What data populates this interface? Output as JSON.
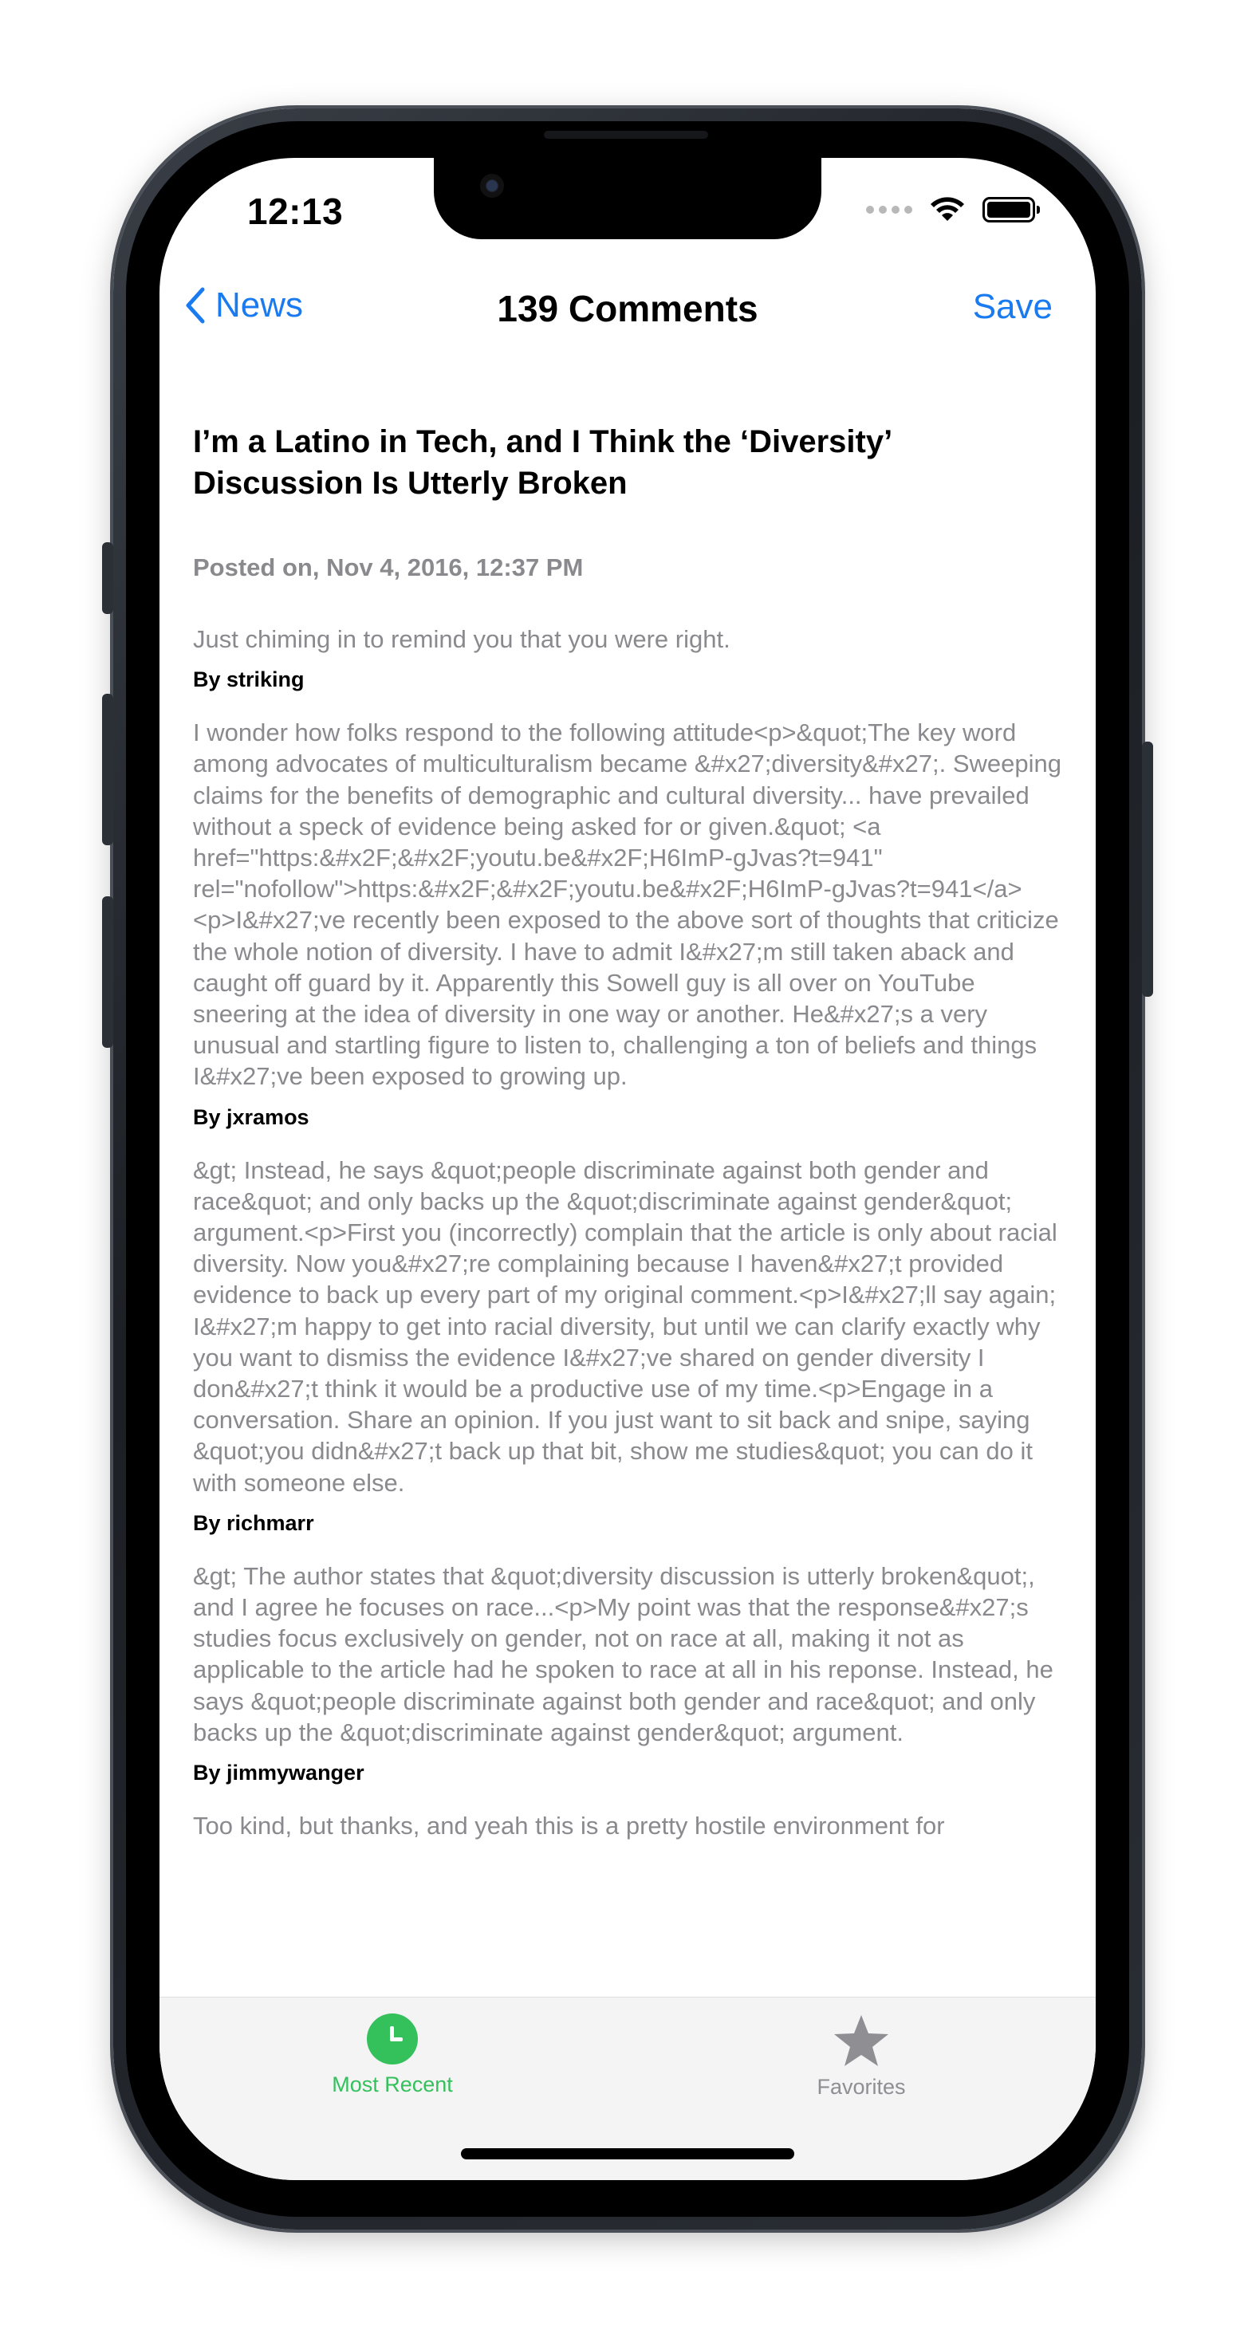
{
  "status_bar": {
    "time": "12:13"
  },
  "nav": {
    "back_label": "News",
    "title": "139 Comments",
    "save_label": "Save"
  },
  "article": {
    "title": "I’m a Latino in Tech, and I Think the ‘Diversity’ Discussion Is Utterly Broken",
    "posted": "Posted on, Nov 4, 2016, 12:37 PM"
  },
  "comments": [
    {
      "text": "Just chiming in to remind you that you were right.",
      "author": "By striking"
    },
    {
      "text": "I wonder how folks respond to the following attitude<p>&quot;The key word among advocates of multiculturalism became &#x27;diversity&#x27;. Sweeping claims for the benefits of demographic and cultural diversity... have prevailed without a speck of evidence being asked for or given.&quot; <a href=\"https:&#x2F;&#x2F;youtu.be&#x2F;H6ImP-gJvas?t=941\" rel=\"nofollow\">https:&#x2F;&#x2F;youtu.be&#x2F;H6ImP-gJvas?t=941</a><p>I&#x27;ve recently been exposed to the above sort of thoughts that criticize the whole notion of diversity. I have to admit I&#x27;m still taken aback and caught off guard by it. Apparently this Sowell guy is all over on YouTube sneering at the idea of diversity in one way or another. He&#x27;s a very unusual and startling figure to listen to, challenging a ton of beliefs and things I&#x27;ve been exposed to growing up.",
      "author": "By jxramos"
    },
    {
      "text": "&gt; Instead, he says &quot;people discriminate against both gender and race&quot; and only backs up the &quot;discriminate against gender&quot; argument.<p>First you (incorrectly) complain that the article is only about racial diversity. Now you&#x27;re complaining because I haven&#x27;t provided evidence to back up every part of my original comment.<p>I&#x27;ll say again; I&#x27;m happy to get into racial diversity, but until we can clarify exactly why you want to dismiss the evidence I&#x27;ve shared on gender diversity I don&#x27;t think it would be a productive use of my time.<p>Engage in a conversation. Share an opinion. If you just want to sit back and snipe, saying &quot;you didn&#x27;t back up that bit, show me studies&quot; you can do it with someone else.",
      "author": "By richmarr"
    },
    {
      "text": "&gt; The author states that &quot;diversity discussion is utterly broken&quot;, and I agree he focuses on race...<p>My point was that the response&#x27;s studies focus exclusively on gender, not on race at all, making it not as applicable to the article had he spoken to race at all in his reponse. Instead, he says &quot;people discriminate against both gender and race&quot; and only backs up the &quot;discriminate against gender&quot; argument.",
      "author": "By jimmywanger"
    },
    {
      "text": "Too kind, but thanks, and yeah this is a pretty hostile environment for",
      "author": ""
    }
  ],
  "tabbar": {
    "recent_label": "Most Recent",
    "favorites_label": "Favorites",
    "active_color": "#34c15b",
    "inactive_color": "#8e8e93"
  },
  "icons": [
    "back-chevron-icon",
    "wifi-icon",
    "battery-icon",
    "clock-icon",
    "star-icon"
  ]
}
